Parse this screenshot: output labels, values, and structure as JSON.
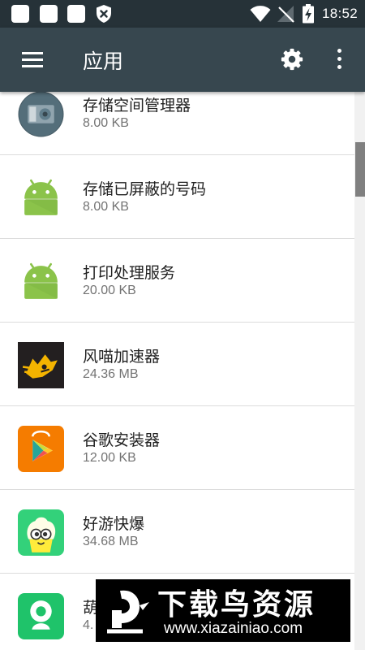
{
  "status_bar": {
    "time": "18:52"
  },
  "toolbar": {
    "title": "应用"
  },
  "apps": [
    {
      "name": "存储空间管理器",
      "size": "8.00 KB",
      "icon": "storage-manager-icon"
    },
    {
      "name": "存储已屏蔽的号码",
      "size": "8.00 KB",
      "icon": "android-icon"
    },
    {
      "name": "打印处理服务",
      "size": "20.00 KB",
      "icon": "android-icon"
    },
    {
      "name": "风喵加速器",
      "size": "24.36 MB",
      "icon": "fengmiao-accelerator-icon"
    },
    {
      "name": "谷歌安装器",
      "size": "12.00 KB",
      "icon": "google-installer-icon"
    },
    {
      "name": "好游快爆",
      "size": "34.68 MB",
      "icon": "haoyou-kuaibao-icon"
    },
    {
      "name": "葫",
      "size": "4.",
      "icon": "green-app-icon"
    }
  ],
  "watermark": {
    "title": "下载鸟资源",
    "url": "www.xiazainiao.com"
  },
  "colors": {
    "status_bar": "#263238",
    "toolbar": "#37474f",
    "android_green": "#8bc34a",
    "divider": "#dcdcdc"
  }
}
